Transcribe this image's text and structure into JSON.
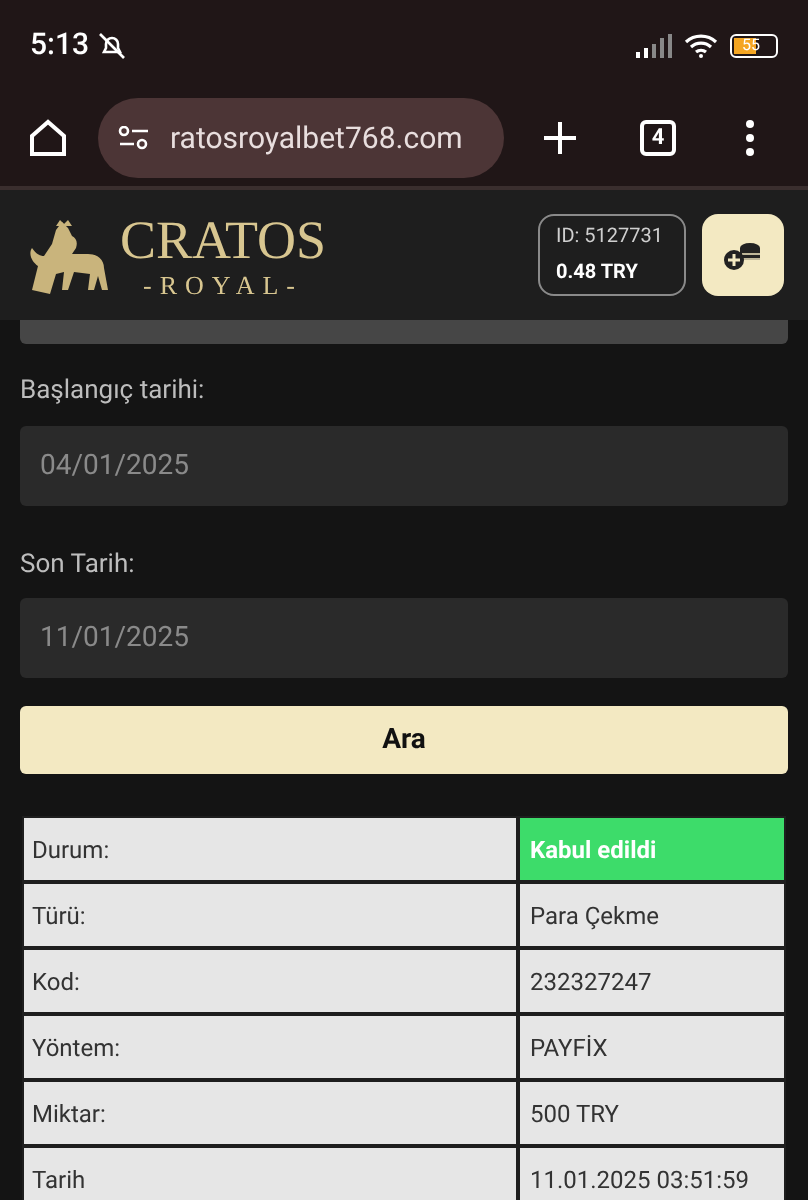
{
  "status_bar": {
    "time": "5:13",
    "battery": "55"
  },
  "browser": {
    "url": "ratosroyalbet768.com",
    "tab_count": "4"
  },
  "header": {
    "logo_title": "CRATOS",
    "logo_subtitle": "-ROYAL-",
    "account_id": "ID: 5127731",
    "balance": "0.48 TRY"
  },
  "form": {
    "fields": [
      {
        "label": "Başlangıç tarihi:",
        "value": "04/01/2025"
      },
      {
        "label": "Son Tarih:",
        "value": "11/01/2025"
      }
    ],
    "search_button": "Ara"
  },
  "details": [
    {
      "kind": "status",
      "label": "Durum:",
      "value": "Kabul edildi"
    },
    {
      "kind": "plain",
      "label": "Türü:",
      "value": "Para Çekme"
    },
    {
      "kind": "plain",
      "label": "Kod:",
      "value": "232327247"
    },
    {
      "kind": "plain",
      "label": "Yöntem:",
      "value": "PAYFİX"
    },
    {
      "kind": "plain",
      "label": "Miktar:",
      "value": "500 TRY"
    },
    {
      "kind": "plain",
      "label": "Tarih",
      "value": "11.01.2025 03:51:59"
    }
  ]
}
